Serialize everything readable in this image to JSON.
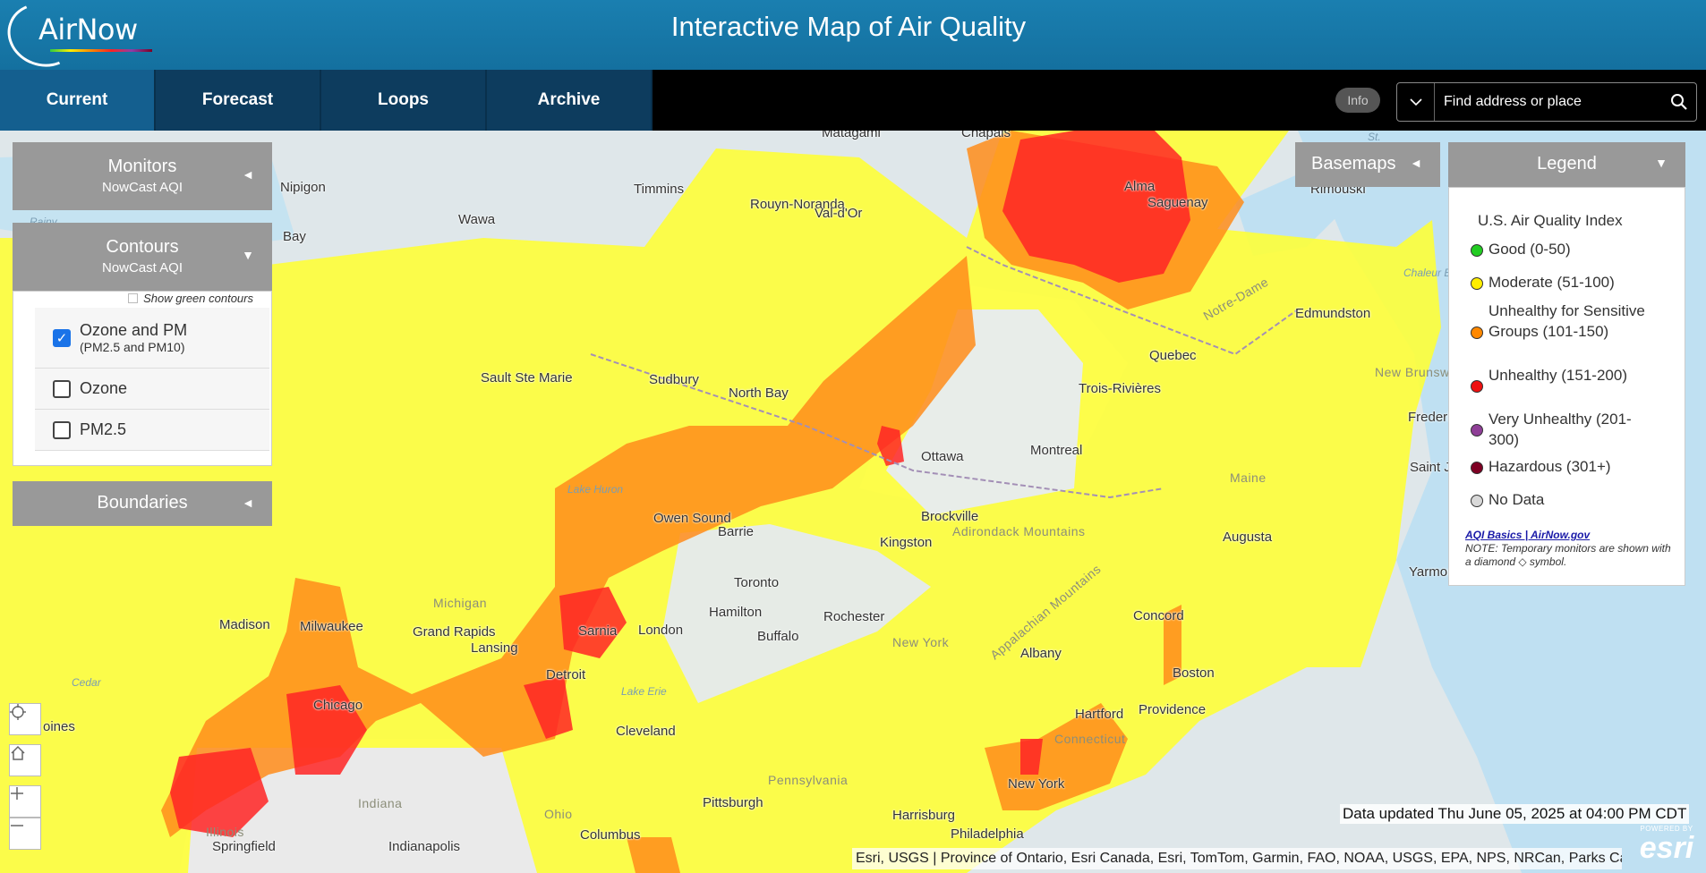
{
  "header": {
    "logo_text": "AirNow",
    "title": "Interactive Map of Air Quality"
  },
  "nav": {
    "tabs": [
      {
        "label": "Current",
        "active": true
      },
      {
        "label": "Forecast",
        "active": false
      },
      {
        "label": "Loops",
        "active": false
      },
      {
        "label": "Archive",
        "active": false
      }
    ],
    "info_label": "Info",
    "search_placeholder": "Find address or place"
  },
  "panels": {
    "monitors": {
      "title": "Monitors",
      "subtitle": "NowCast AQI",
      "caret": "◄"
    },
    "contours": {
      "title": "Contours",
      "subtitle": "NowCast AQI",
      "caret": "▼",
      "show_green_label": "Show green contours",
      "layers": [
        {
          "label": "Ozone and PM",
          "sublabel": "(PM2.5 and PM10)",
          "checked": true
        },
        {
          "label": "Ozone",
          "sublabel": "",
          "checked": false
        },
        {
          "label": "PM2.5",
          "sublabel": "",
          "checked": false
        }
      ]
    },
    "boundaries": {
      "title": "Boundaries",
      "caret": "◄"
    }
  },
  "basemaps": {
    "title": "Basemaps",
    "caret": "◄"
  },
  "legend": {
    "title": "Legend",
    "caret": "▼",
    "heading": "U.S. Air Quality Index",
    "items": [
      {
        "label": "Good (0-50)",
        "color": "#22cc22"
      },
      {
        "label": "Moderate (51-100)",
        "color": "#ffee00"
      },
      {
        "label": "Unhealthy for Sensitive Groups (101-150)",
        "color": "#ff8800"
      },
      {
        "label": "Unhealthy (151-200)",
        "color": "#ee1111"
      },
      {
        "label": "Very Unhealthy (201-300)",
        "color": "#8f3f97"
      },
      {
        "label": "Hazardous (301+)",
        "color": "#7e0023"
      },
      {
        "label": "No Data",
        "color": "#d8d8d8"
      }
    ],
    "link_text": "AQI Basics | AirNow.gov",
    "note": "NOTE: Temporary monitors are shown with a diamond ◇ symbol."
  },
  "map": {
    "cities": [
      "Nipigon",
      "Timmins",
      "Wawa",
      "Rouyn-Noranda",
      "Val-d'Or",
      "Matagami",
      "Chapais",
      "Alma",
      "Saguenay",
      "Rimouski",
      "Sault Ste Marie",
      "Sudbury",
      "North Bay",
      "Quebec",
      "Trois-Rivières",
      "Edmundston",
      "Fredericton",
      "Saint J",
      "Ottawa",
      "Montreal",
      "Owen Sound",
      "Barrie",
      "Brockville",
      "Kingston",
      "Augusta",
      "Toronto",
      "Hamilton",
      "Rochester",
      "Buffalo",
      "London",
      "Sarnia",
      "Madison",
      "Milwaukee",
      "Grand Rapids",
      "Lansing",
      "Detroit",
      "Chicago",
      "Cleveland",
      "Concord",
      "Albany",
      "Boston",
      "Hartford",
      "Providence",
      "New York",
      "Pittsburgh",
      "Harrisburg",
      "Philadelphia",
      "Columbus",
      "Indianapolis",
      "Springfield",
      "Yarmou",
      "Bay",
      "oines"
    ],
    "regions": [
      "Michigan",
      "Ohio",
      "Indiana",
      "Pennsylvania",
      "New York",
      "Maine",
      "New Brunswick",
      "Adirondack Mountains",
      "Appalachian Mountains",
      "Notre-Dame",
      "Connecticut",
      "Illinois"
    ],
    "water": [
      "Lake Huron",
      "Lake Erie",
      "Rainy",
      "Cedar",
      "Chaleur Bay",
      "St."
    ],
    "data_updated": "Data updated Thu June 05, 2025 at 04:00 PM CDT",
    "attribution": "Esri, USGS | Province of Ontario, Esri Canada, Esri, TomTom, Garmin, FAO, NOAA, USGS, EPA, NPS, NRCan, Parks Ca...",
    "esri_powered": "POWERED BY",
    "esri_name": "esri"
  }
}
